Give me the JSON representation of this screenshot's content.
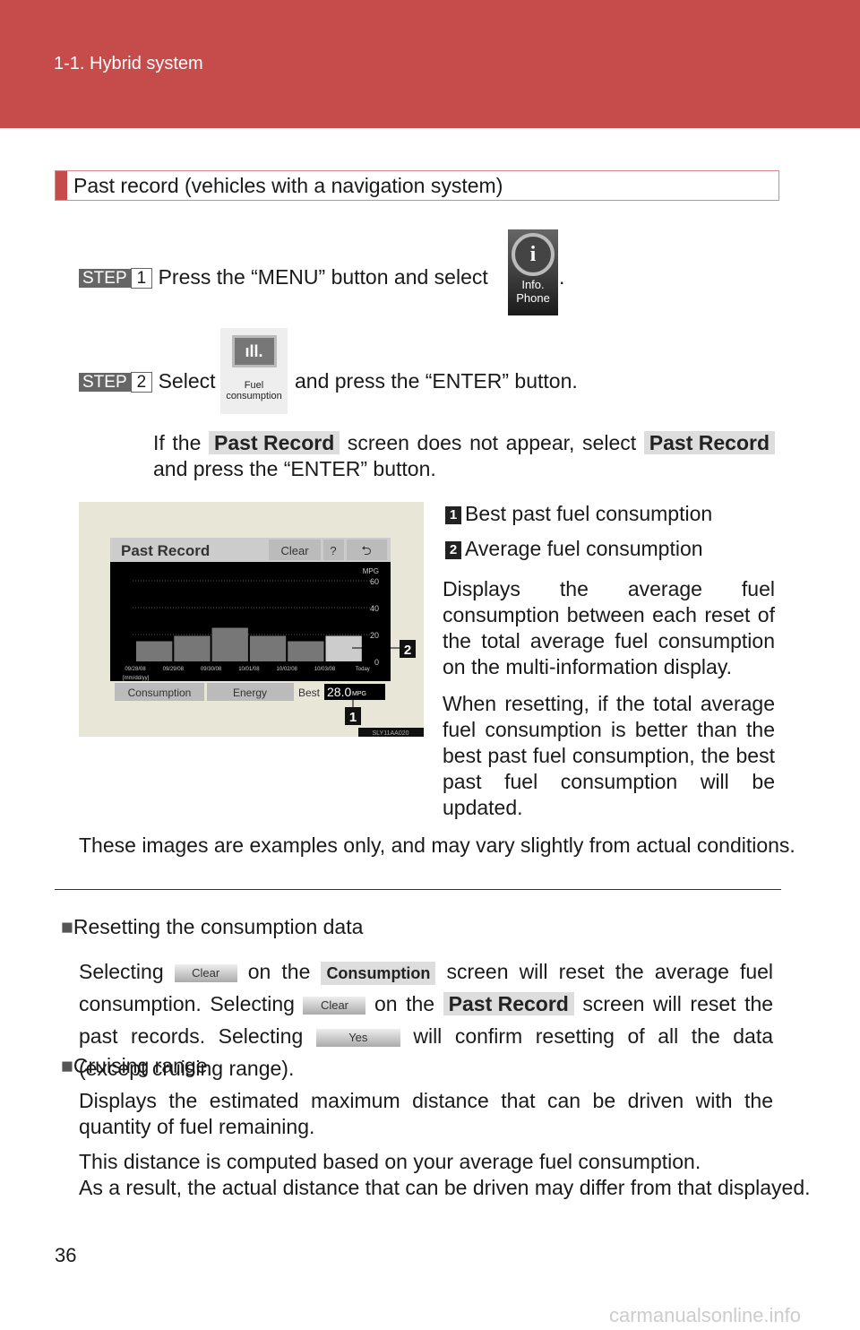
{
  "header": {
    "section": "1-1. Hybrid system"
  },
  "section_title": "Past record (vehicles with a navigation system)",
  "steps": [
    {
      "label": "STEP",
      "number": "1",
      "text": "Press the “MENU” button and select",
      "after": ".",
      "icon": {
        "name": "info-phone-icon",
        "line1": "Info.",
        "line2": "Phone"
      }
    },
    {
      "label": "STEP",
      "number": "2",
      "text_before": "Select",
      "text_after": "and press the “ENTER” button.",
      "icon": {
        "name": "fuel-consumption-icon",
        "line1": "Fuel",
        "line2": "consumption"
      }
    }
  ],
  "note": {
    "p1": "If the",
    "chip1": "Past Record",
    "p2": "screen does not appear, select",
    "chip2": "Past Record",
    "p3": "and press the “ENTER” button."
  },
  "screen": {
    "title": "Past Record",
    "clear": "Clear",
    "help": "?",
    "back": "⮌",
    "unit": "MPG",
    "yticks": [
      "60",
      "40",
      "20",
      "0"
    ],
    "dates": [
      "09/28/08",
      "09/29/08",
      "09/30/08",
      "10/01/08",
      "10/02/08",
      "10/03/08",
      "Today"
    ],
    "date_format": "[mm/dd/yy]",
    "tab1": "Consumption",
    "tab2": "Energy",
    "best_label": "Best",
    "best_value": "28.0",
    "best_unit": "MPG",
    "callout1": "1",
    "callout2": "2",
    "code": "SLY11AA020"
  },
  "chart_data": {
    "type": "bar",
    "categories": [
      "09/28/08",
      "09/29/08",
      "09/30/08",
      "10/01/08",
      "10/02/08",
      "10/03/08",
      "Today"
    ],
    "values": [
      15,
      19,
      25,
      19,
      15,
      19
    ],
    "ylim": [
      0,
      60
    ],
    "ylabel": "MPG",
    "grid": true
  },
  "legend": [
    {
      "num": "1",
      "text": "Best past fuel consumption"
    },
    {
      "num": "2",
      "text": "Average fuel consumption"
    }
  ],
  "desc1": "Displays the average fuel consumption between each reset of the total average fuel consumption on the multi-information display.",
  "desc2": "When resetting, if the total average fuel consumption is better than the best past fuel consumption, the best past fuel consumption will be updated.",
  "disclaimer": "These images are examples only, and may vary slightly from actual conditions.",
  "reset": {
    "heading": "Resetting the consumption data",
    "s1": "Selecting",
    "b1": "Clear",
    "s2": "on the",
    "c1": "Consumption",
    "s3": "screen will reset the average fuel consumption. Selecting",
    "b2": "Clear",
    "s4": "on the",
    "c2": "Past Record",
    "s5": "screen will reset the past records. Selecting",
    "b3": "Yes",
    "s6": "will confirm resetting of all the data (except cruising range)."
  },
  "cruising": {
    "heading": "Cruising range",
    "p1": "Displays the estimated maximum distance that can be driven with the quantity of fuel remaining.",
    "p2": "This distance is computed based on your average fuel consumption.",
    "p3": "As a result, the actual distance that can be driven may differ from that displayed."
  },
  "page_number": "36",
  "watermark": "carmanualsonline.info"
}
